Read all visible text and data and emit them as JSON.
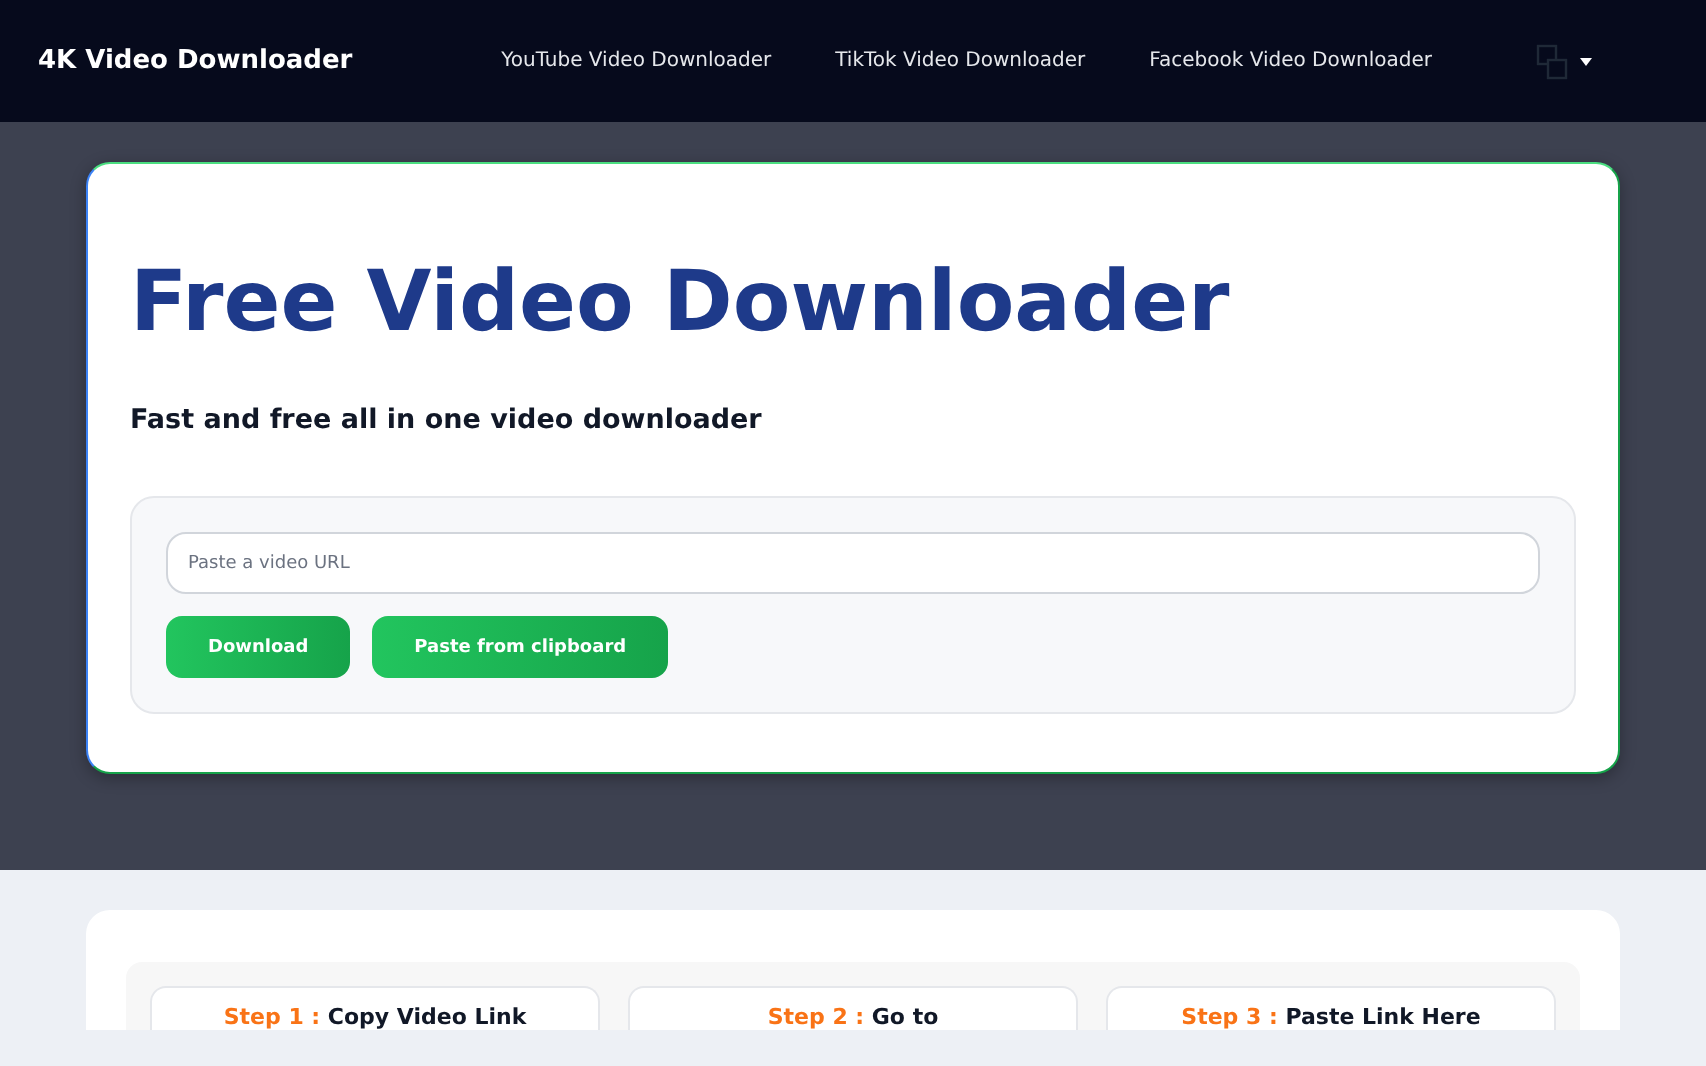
{
  "navbar": {
    "brand": "4K Video Downloader",
    "links": [
      "YouTube Video Downloader",
      "TikTok Video Downloader",
      "Facebook Video Downloader"
    ]
  },
  "hero": {
    "title": "Free Video Downloader",
    "subtitle": "Fast and free all in one video downloader",
    "url_field": {
      "placeholder": "Paste a video URL"
    },
    "buttons": [
      "Download",
      "Paste from clipboard"
    ]
  },
  "steps": [
    {
      "label": "Step 1 :",
      "title": "Copy Video Link"
    },
    {
      "label": "Step 2 :",
      "title": "Go to"
    },
    {
      "label": "Step 3 :",
      "title": "Paste Link Here"
    }
  ]
}
